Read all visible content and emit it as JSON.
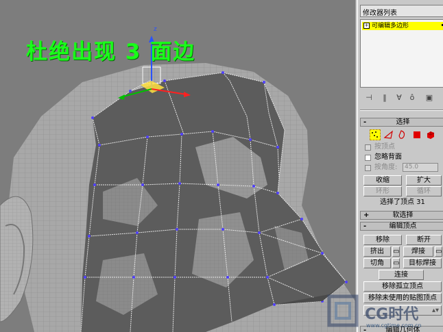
{
  "viewport": {
    "overlay_text": "杜绝出现 3 面边",
    "gizmo_axis_label": "z",
    "colors": {
      "background": "#7d7d7d",
      "overlay_text": "#19ff19",
      "polygon_fill": "#5a5a5a",
      "vertex": "#5040ff"
    }
  },
  "panel": {
    "modifier_list_label": "修改器列表",
    "stack_item_label": "可编辑多边形",
    "toolbar_icons": [
      "pin-stack-icon",
      "show-end-result-icon",
      "make-unique-icon",
      "remove-modifier-icon",
      "configure-sets-icon"
    ],
    "selection": {
      "header": "选择",
      "by_vertex_label": "按顶点",
      "ignore_backfacing_label": "忽略背面",
      "by_angle_label": "按角度:",
      "angle_value": "45.0",
      "shrink_label": "收缩",
      "grow_label": "扩大",
      "ring_label": "环形",
      "loop_label": "循环",
      "status": "选择了顶点 31"
    },
    "soft_selection_header": "软选择",
    "edit_vertices": {
      "header": "编辑顶点",
      "remove_label": "移除",
      "break_label": "断开",
      "extrude_label": "挤出",
      "weld_label": "焊接",
      "chamfer_label": "切角",
      "target_weld_label": "目标焊接",
      "connect_label": "连接",
      "remove_isolated_label": "移除孤立顶点",
      "remove_unused_map_label": "移除未使用的贴图顶点"
    },
    "bottom_partial_label": "编辑几何体"
  },
  "watermark": {
    "logo_text": "CG时代",
    "url_text": "www.cgtime.com.cn"
  }
}
